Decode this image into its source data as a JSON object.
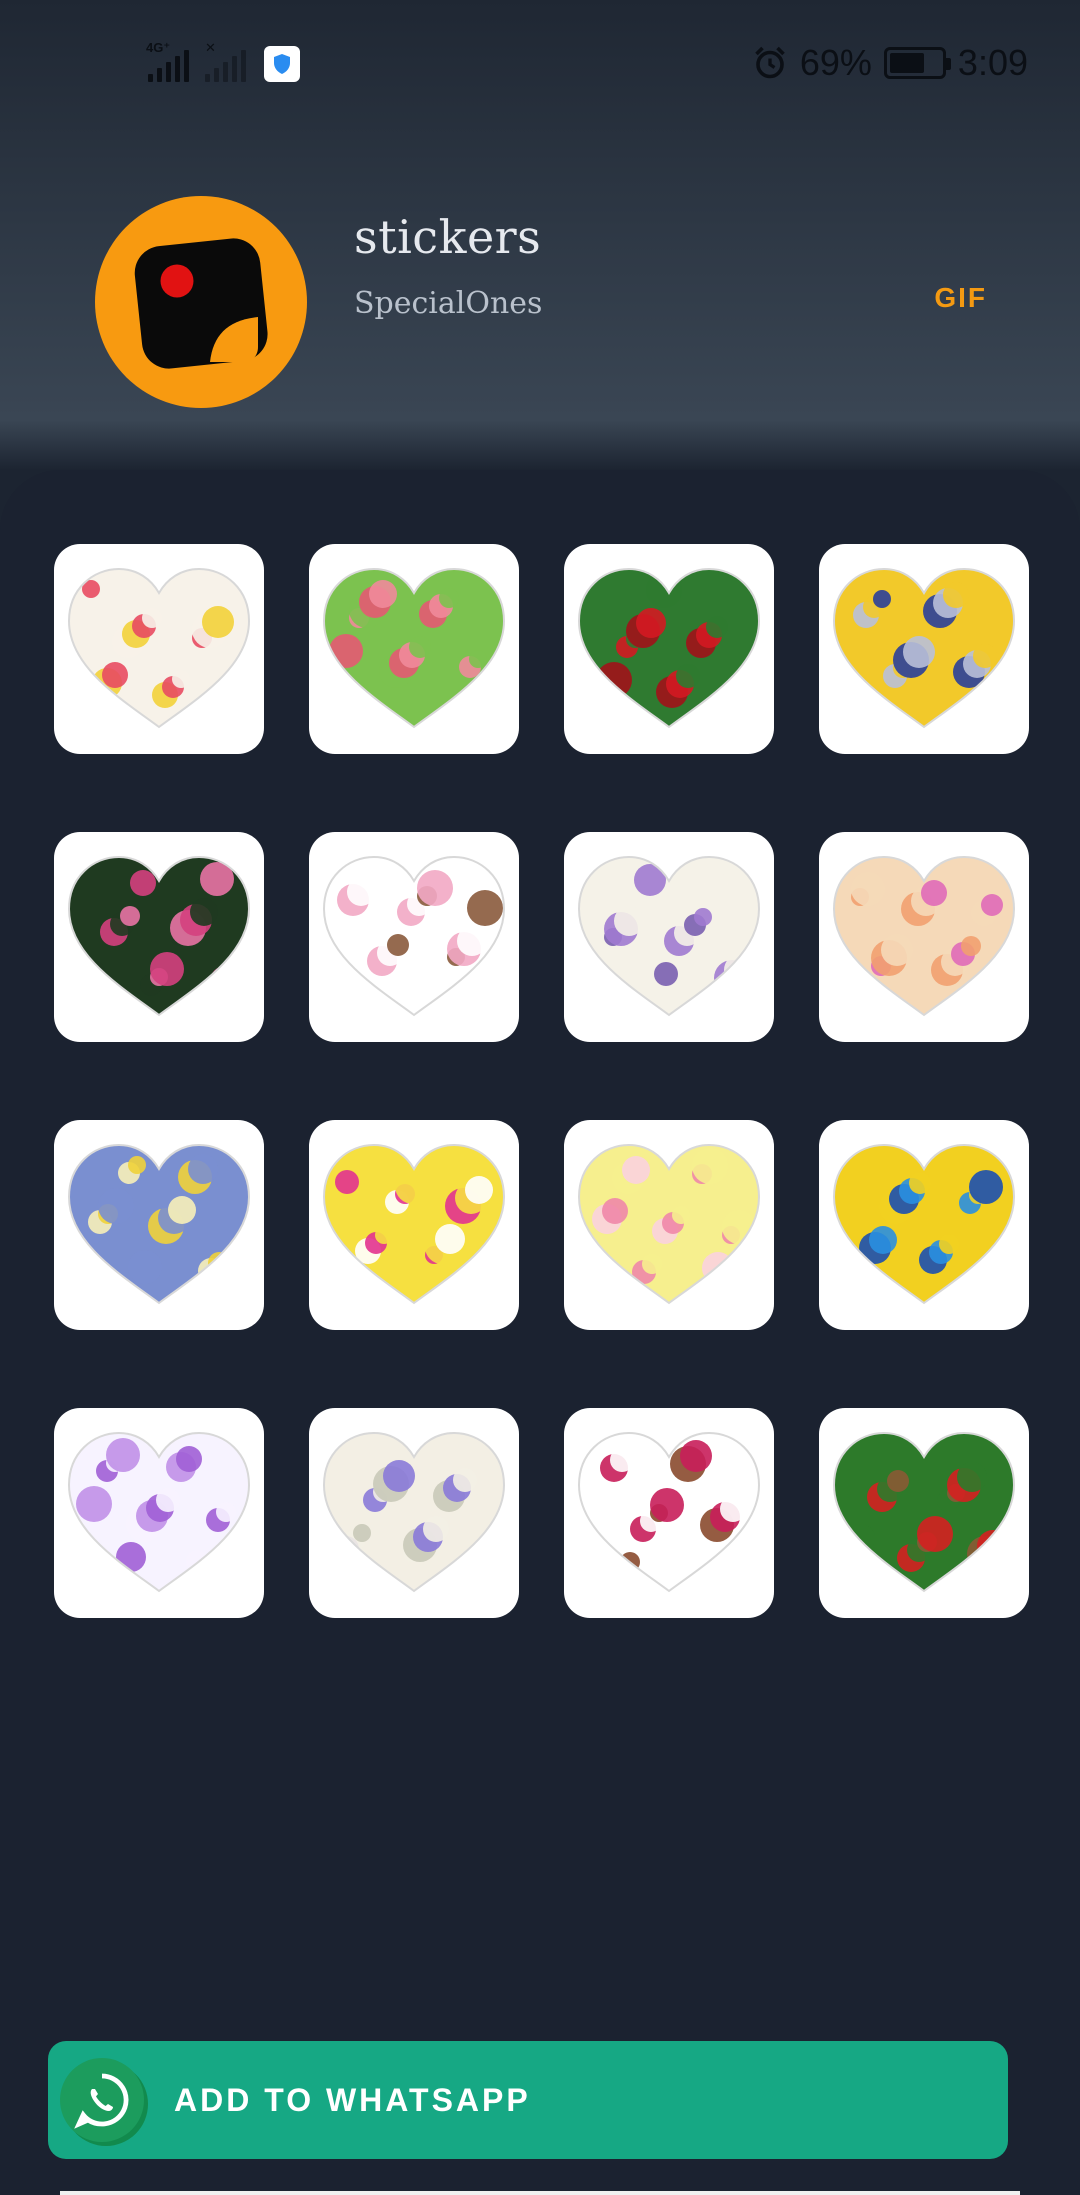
{
  "status_bar": {
    "network_tag_1": "4G⁺",
    "network_tag_2": "✕",
    "battery_percent": "69%",
    "time": "3:09",
    "battery_level": 0.69
  },
  "pack": {
    "title": "stickers",
    "author": "SpecialOnes",
    "badge": "GIF",
    "accent_color": "#f89a10"
  },
  "stickers": [
    {
      "name": "sticker-heart-bunny-kisses",
      "colors": [
        "#e84b62",
        "#f7f2e9",
        "#f2d23a"
      ]
    },
    {
      "name": "sticker-heart-pink-roses",
      "colors": [
        "#f08a9a",
        "#7cc24f",
        "#e45a72"
      ]
    },
    {
      "name": "sticker-heart-red-roses",
      "colors": [
        "#d31a22",
        "#2f7a30",
        "#a1121a"
      ]
    },
    {
      "name": "sticker-heart-blue-vase-yellow",
      "colors": [
        "#b9c0d8",
        "#f2c92a",
        "#2a3f9a"
      ]
    },
    {
      "name": "sticker-heart-pink-rose",
      "colors": [
        "#d4407e",
        "#1f3a20",
        "#e873a4"
      ]
    },
    {
      "name": "sticker-heart-bunny-pink-bouquet",
      "colors": [
        "#f2a9c4",
        "#ffffff",
        "#8a5a3c"
      ]
    },
    {
      "name": "sticker-heart-purple-daisies",
      "colors": [
        "#a07ad0",
        "#f5f2e8",
        "#7a5fb0"
      ]
    },
    {
      "name": "sticker-heart-peach-flowers",
      "colors": [
        "#f2a070",
        "#f5d9b8",
        "#e06ab8"
      ]
    },
    {
      "name": "sticker-heart-yellow-flowers",
      "colors": [
        "#efd23a",
        "#7a8fd0",
        "#f7f0b8"
      ]
    },
    {
      "name": "sticker-heart-tulips-bouquet",
      "colors": [
        "#e2338f",
        "#f6e040",
        "#ffffff"
      ]
    },
    {
      "name": "sticker-heart-envelope-roses",
      "colors": [
        "#f087a8",
        "#f6ef8e",
        "#fbd2de"
      ]
    },
    {
      "name": "sticker-heart-blue-yellow-roses",
      "colors": [
        "#2a8fe0",
        "#f2d020",
        "#1b4fb0"
      ]
    },
    {
      "name": "sticker-heart-purple-white-flowers",
      "colors": [
        "#a05fd6",
        "#f7f3ff",
        "#c090e8"
      ]
    },
    {
      "name": "sticker-heart-asters-white-roses",
      "colors": [
        "#8a7ad8",
        "#f3efe4",
        "#c9c9b8"
      ]
    },
    {
      "name": "sticker-heart-bunny-magenta-roses",
      "colors": [
        "#c81e5a",
        "#ffffff",
        "#8a4a2e"
      ]
    },
    {
      "name": "sticker-heart-bear-red-roses",
      "colors": [
        "#d42020",
        "#2d7a2a",
        "#8a5a34"
      ]
    }
  ],
  "action": {
    "add_label": "ADD TO WHATSAPP",
    "button_color": "#16a884"
  }
}
